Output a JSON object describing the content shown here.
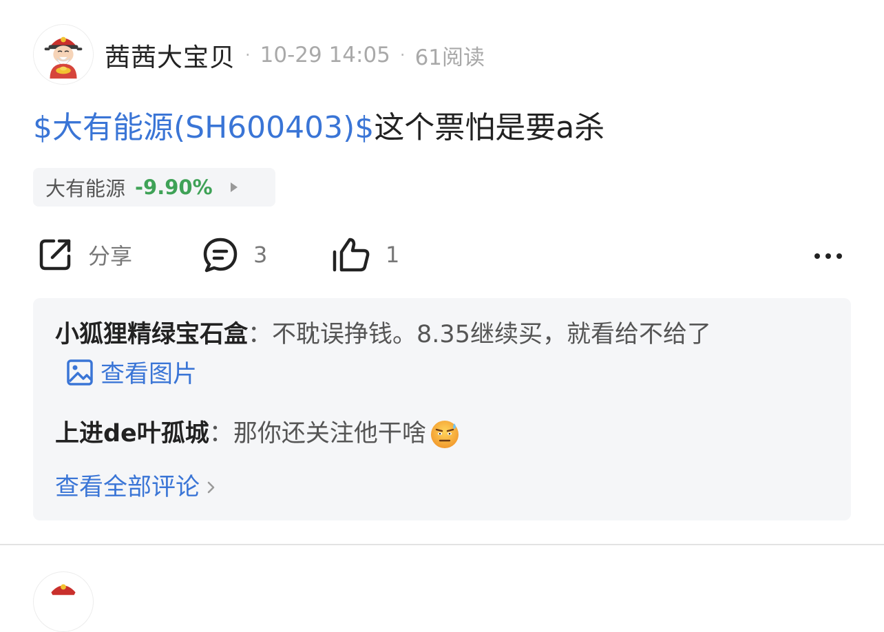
{
  "post": {
    "author": {
      "name": "茜茜大宝贝",
      "avatar_icon": "fortune-god-avatar-icon"
    },
    "meta": {
      "separator": "·",
      "datetime": "10-29 14:05",
      "reads": "61阅读"
    },
    "content": {
      "stock_link": "$大有能源(SH600403)$",
      "text": "这个票怕是要a杀"
    },
    "stock_chip": {
      "name": "大有能源",
      "change": "-9.90%",
      "change_color": "#3fa257",
      "arrow_icon": "triangle-right-icon"
    },
    "actions": {
      "share_label": "分享",
      "comment_count": "3",
      "like_count": "1",
      "more_icon": "more-dots-icon"
    },
    "comments": [
      {
        "author": "小狐狸精绿宝石盒",
        "separator": "：",
        "text": "不耽误挣钱。8.35继续买，就看给不给了",
        "image_link": "查看图片",
        "image_icon": "image-icon"
      },
      {
        "author": "上进de叶孤城",
        "separator": "：",
        "text": "那你还关注他干啥",
        "emoji_icon": "sweat-smile-emoji-icon"
      }
    ],
    "view_all_comments": "查看全部评论"
  },
  "colors": {
    "link_blue": "#3a75d6",
    "meta_gray": "#a9a9a9",
    "panel_bg": "#f5f6f8",
    "down_green": "#3fa257"
  }
}
